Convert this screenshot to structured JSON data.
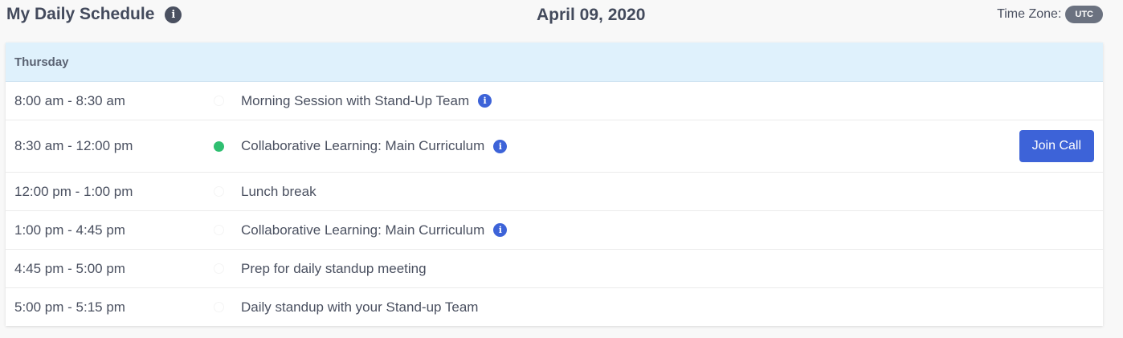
{
  "header": {
    "title": "My Daily Schedule",
    "title_info_icon": "info-icon",
    "date": "April 09, 2020",
    "timezone_label": "Time Zone:",
    "timezone_value": "UTC"
  },
  "schedule": {
    "day": "Thursday",
    "rows": [
      {
        "time": "8:00 am - 8:30 am",
        "title": "Morning Session with Stand-Up Team",
        "active": false,
        "has_info": true
      },
      {
        "time": "8:30 am - 12:00 pm",
        "title": "Collaborative Learning: Main Curriculum",
        "active": true,
        "has_info": true,
        "action": "Join Call"
      },
      {
        "time": "12:00 pm - 1:00 pm",
        "title": "Lunch break",
        "active": false,
        "has_info": false
      },
      {
        "time": "1:00 pm - 4:45 pm",
        "title": "Collaborative Learning: Main Curriculum",
        "active": false,
        "has_info": true
      },
      {
        "time": "4:45 pm - 5:00 pm",
        "title": "Prep for daily standup meeting",
        "active": false,
        "has_info": false
      },
      {
        "time": "5:00 pm - 5:15 pm",
        "title": "Daily standup with your Stand-up Team",
        "active": false,
        "has_info": false
      }
    ]
  },
  "colors": {
    "accent": "#3d63d8",
    "active_dot": "#2fbf71",
    "day_header_bg": "#dff1fc",
    "badge_bg": "#6b7280"
  }
}
